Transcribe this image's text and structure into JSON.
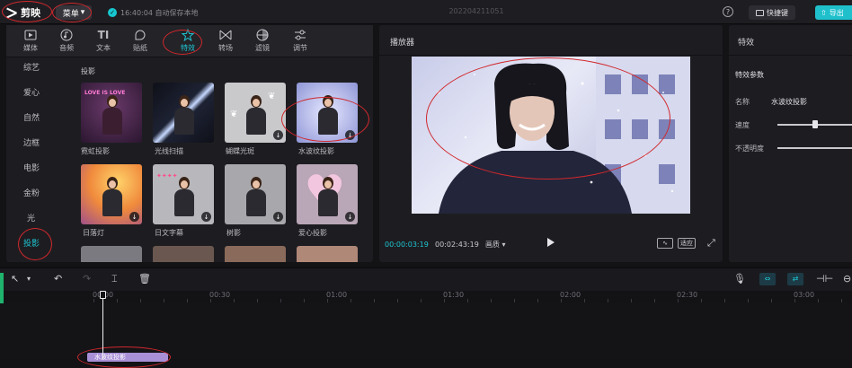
{
  "app": {
    "name": "剪映",
    "menu_label": "菜单",
    "save_status": "16:40:04 自动保存本地",
    "project_name": "202204211051",
    "shortcut_label": "快捷键",
    "export_label": "导出"
  },
  "tabs": [
    {
      "label": "媒体",
      "icon": "media-icon"
    },
    {
      "label": "音频",
      "icon": "audio-icon"
    },
    {
      "label": "文本",
      "icon": "text-icon"
    },
    {
      "label": "贴纸",
      "icon": "sticker-icon"
    },
    {
      "label": "特效",
      "icon": "effects-icon",
      "active": true
    },
    {
      "label": "转场",
      "icon": "transition-icon"
    },
    {
      "label": "滤镜",
      "icon": "filter-icon"
    },
    {
      "label": "调节",
      "icon": "adjust-icon"
    }
  ],
  "categories": [
    "综艺",
    "爱心",
    "自然",
    "边框",
    "电影",
    "金粉",
    "光",
    "投影"
  ],
  "active_category": "投影",
  "section_title": "投影",
  "effects": [
    {
      "label": "霓虹投影",
      "thumb_text": "LOVE IS LOVE"
    },
    {
      "label": "光线扫描",
      "thumb_text": ""
    },
    {
      "label": "蝴蝶光斑",
      "thumb_text": ""
    },
    {
      "label": "水波纹投影",
      "thumb_text": ""
    },
    {
      "label": "日落灯",
      "thumb_text": ""
    },
    {
      "label": "日文字幕",
      "thumb_text": ""
    },
    {
      "label": "树影",
      "thumb_text": ""
    },
    {
      "label": "爱心投影",
      "thumb_text": ""
    }
  ],
  "player": {
    "title": "播放器",
    "current_time": "00:00:03:19",
    "total_time": "00:02:43:19",
    "quality": "画质",
    "fit_label": "适应"
  },
  "fx_panel": {
    "title": "特效",
    "params_title": "特效参数",
    "name_label": "名称",
    "name_value": "水波纹投影",
    "speed_label": "速度",
    "opacity_label": "不透明度",
    "speed": 0.5,
    "opacity": 0.6
  },
  "timeline": {
    "ruler_labels": [
      "00:00",
      "00:30",
      "01:00",
      "01:30",
      "02:00",
      "02:30",
      "03:00"
    ],
    "clip_label": "水波纹投影"
  },
  "colors": {
    "accent": "#1ec5d2",
    "annotation": "#d0282c",
    "clip": "#a98fd6"
  }
}
